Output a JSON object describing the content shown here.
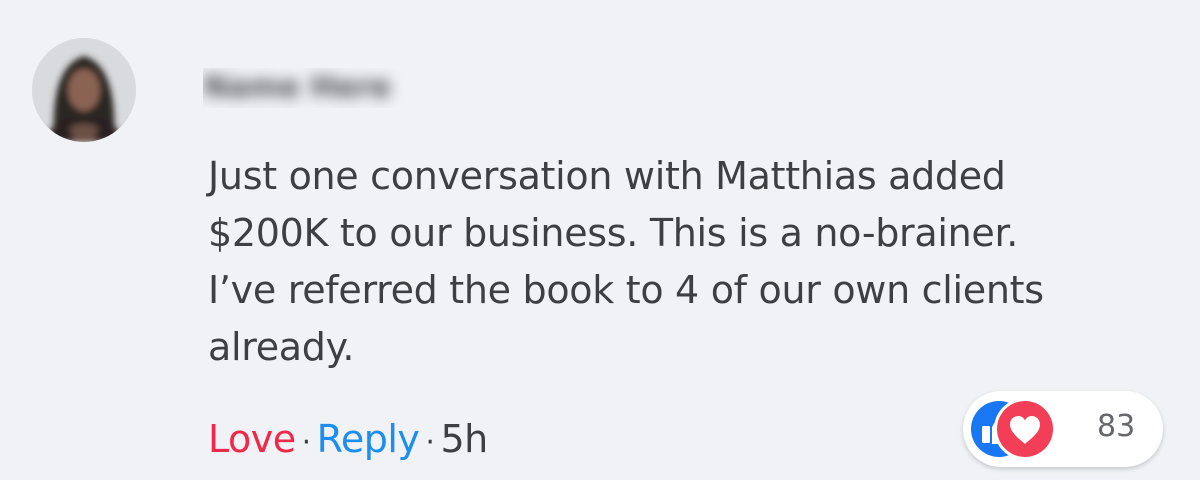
{
  "comment": {
    "author_name": "Name Here",
    "text": "Just one conversation with Matthias added $200K to our business. This is a no-brainer. I’ve referred the book to 4 of our own clients already.",
    "actions": {
      "love_label": "Love",
      "reply_label": "Reply",
      "separator": "·",
      "timestamp": "5h"
    },
    "reactions": {
      "types": [
        "like-icon",
        "love-icon"
      ],
      "count": "83",
      "like_color": "#1877f2",
      "love_color": "#f33e58"
    }
  },
  "colors": {
    "background": "#f0f2f5",
    "love_accent": "#f02849",
    "reply_accent": "#1b8ef0",
    "text": "#3e3f42"
  }
}
